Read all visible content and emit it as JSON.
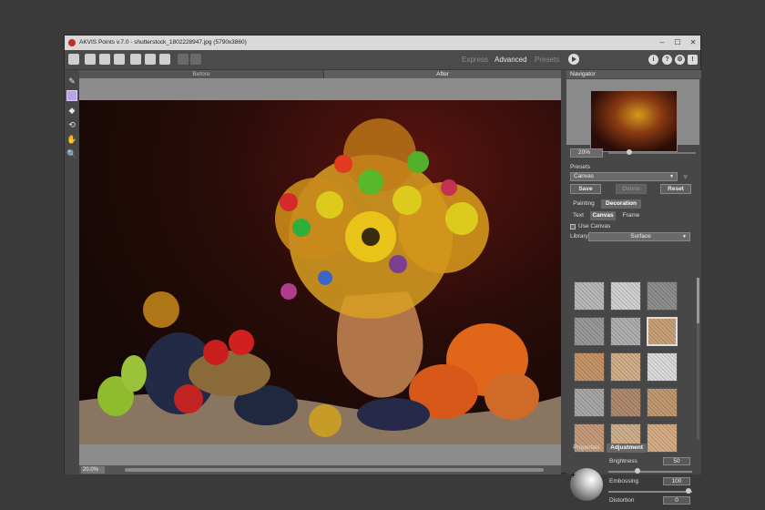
{
  "window": {
    "title": "AKVIS Points v.7.0 - shutterstock_1802228947.jpg (5790x3860)",
    "controls": [
      "–",
      "☐",
      "✕"
    ]
  },
  "toolbar": {
    "modes": [
      "Express",
      "Advanced",
      "Presets"
    ],
    "active_mode": "Advanced"
  },
  "view_tabs": {
    "before": "Before",
    "after": "After"
  },
  "status": {
    "zoom": "20.0%"
  },
  "navigator": {
    "title": "Navigator",
    "zoom": "20%"
  },
  "presets": {
    "title": "Presets",
    "selected": "Canvas",
    "save": "Save",
    "delete": "Delete",
    "reset": "Reset"
  },
  "panel_tabs": {
    "painting": "Painting",
    "decoration": "Decoration"
  },
  "sub_tabs": {
    "text": "Text",
    "canvas": "Canvas",
    "frame": "Frame"
  },
  "canvas": {
    "use_canvas_label": "Use Canvas",
    "library_label": "Library",
    "library_value": "Surface"
  },
  "textures": [
    "#b9b9b9",
    "#d1d1d1",
    "#8f8f8f",
    "#9a9a9a",
    "#b0b0b0",
    "#c9a27a",
    "#c8956a",
    "#d2b08a",
    "#dcdcdc",
    "#a8a8a8",
    "#b08b70",
    "#c29a72",
    "#c79c7c",
    "#cfb08e",
    "#d6ad85"
  ],
  "prop_tabs": {
    "properties": "Properties",
    "adjustment": "Adjustment"
  },
  "adjustment": {
    "brightness_label": "Brightness",
    "brightness": "50",
    "embossing_label": "Embossing",
    "embossing": "100",
    "distortion_label": "Distortion",
    "distortion": "0"
  }
}
